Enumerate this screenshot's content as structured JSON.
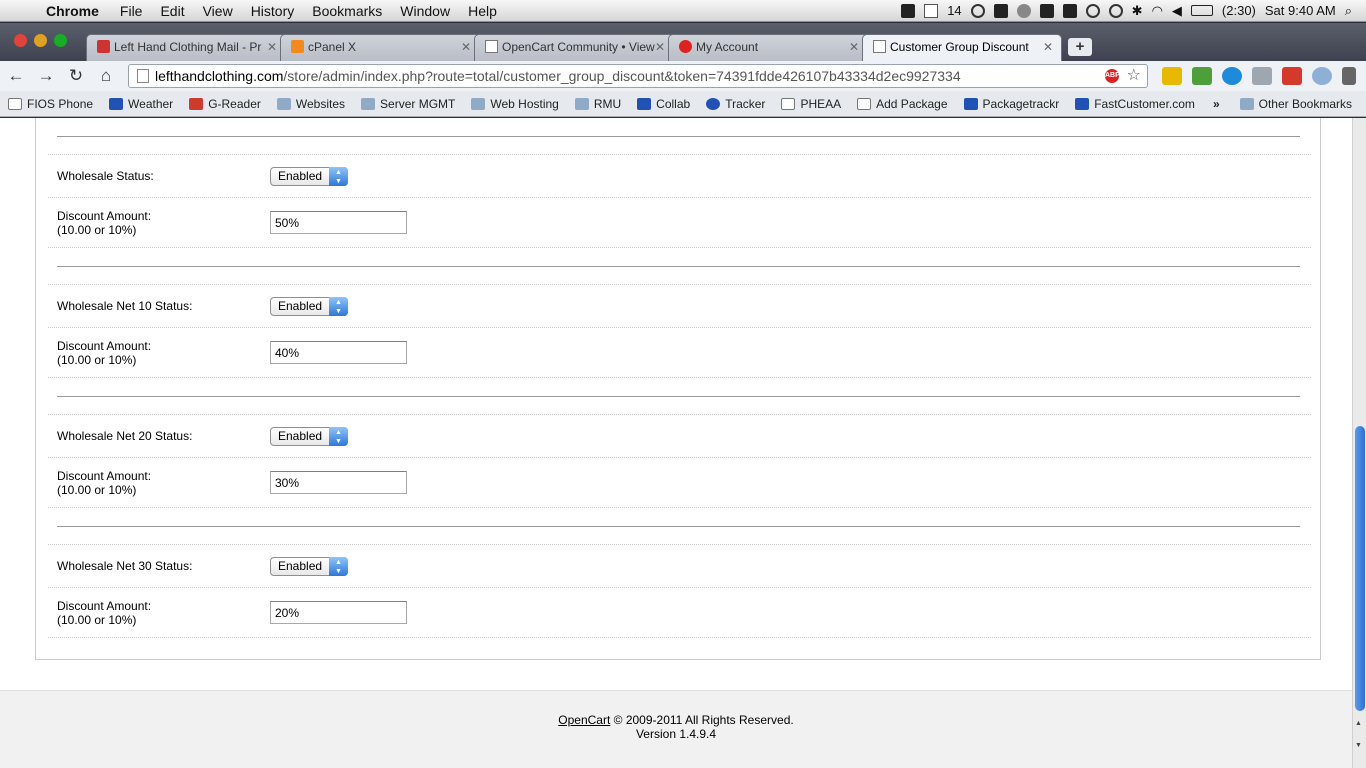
{
  "menubar": {
    "app": "Chrome",
    "items": [
      "File",
      "Edit",
      "View",
      "History",
      "Bookmarks",
      "Window",
      "Help"
    ],
    "notification_count": "14",
    "battery": "(2:30)",
    "clock": "Sat 9:40 AM"
  },
  "tabs": [
    {
      "title": "Left Hand Clothing Mail - Pr",
      "icon": "gmail-icon"
    },
    {
      "title": "cPanel X",
      "icon": "cpanel-icon"
    },
    {
      "title": "OpenCart Community • View",
      "icon": "page-icon"
    },
    {
      "title": "My Account",
      "icon": "hand-icon"
    },
    {
      "title": "Customer Group Discount",
      "icon": "page-icon"
    }
  ],
  "address": {
    "host": "lefthandclothing.com",
    "path": "/store/admin/index.php?route=total/customer_group_discount&token=74391fdde426107b43334d2ec9927334"
  },
  "bookmarks": [
    {
      "label": "FIOS Phone",
      "icon": "page-icon"
    },
    {
      "label": "Weather",
      "icon": "twc-icon"
    },
    {
      "label": "G-Reader",
      "icon": "greader-icon"
    },
    {
      "label": "Websites",
      "icon": "folder-icon"
    },
    {
      "label": "Server MGMT",
      "icon": "folder-icon"
    },
    {
      "label": "Web Hosting",
      "icon": "folder-icon"
    },
    {
      "label": "RMU",
      "icon": "folder-icon"
    },
    {
      "label": "Collab",
      "icon": "collab-icon"
    },
    {
      "label": "Tracker",
      "icon": "tracker-icon"
    },
    {
      "label": "PHEAA",
      "icon": "page-icon"
    },
    {
      "label": "Add Package",
      "icon": "page-icon"
    },
    {
      "label": "Packagetrackr",
      "icon": "package-icon"
    },
    {
      "label": "FastCustomer.com",
      "icon": "fastcustomer-icon"
    }
  ],
  "bookmarks_more": "»",
  "other_bookmarks": "Other Bookmarks",
  "groups": [
    {
      "status_label": "Wholesale Status:",
      "status_value": "Enabled",
      "amount_label": "Discount Amount:",
      "amount_hint": "(10.00 or 10%)",
      "amount_value": "50%"
    },
    {
      "status_label": "Wholesale Net 10 Status:",
      "status_value": "Enabled",
      "amount_label": "Discount Amount:",
      "amount_hint": "(10.00 or 10%)",
      "amount_value": "40%"
    },
    {
      "status_label": "Wholesale Net 20 Status:",
      "status_value": "Enabled",
      "amount_label": "Discount Amount:",
      "amount_hint": "(10.00 or 10%)",
      "amount_value": "30%"
    },
    {
      "status_label": "Wholesale Net 30 Status:",
      "status_value": "Enabled",
      "amount_label": "Discount Amount:",
      "amount_hint": "(10.00 or 10%)",
      "amount_value": "20%"
    }
  ],
  "footer": {
    "link": "OpenCart",
    "copyright": " © 2009-2011 All Rights Reserved.",
    "version": "Version 1.4.9.4"
  },
  "scroll": {
    "position_fraction": 0.95
  }
}
